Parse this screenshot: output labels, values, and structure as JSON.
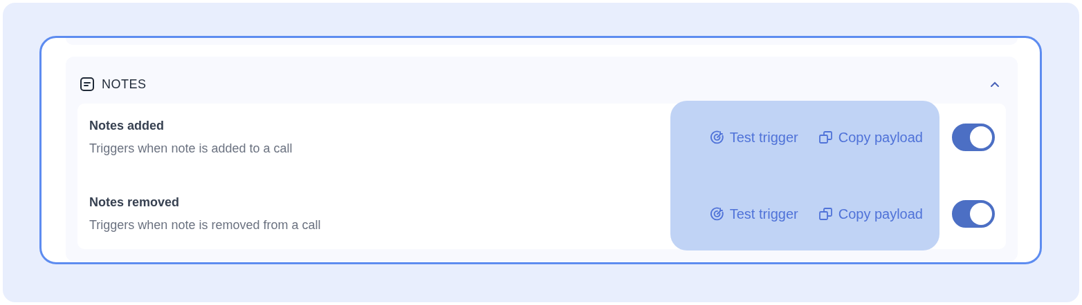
{
  "section": {
    "title": "NOTES",
    "expanded": true,
    "actions_highlighted": true,
    "triggers": [
      {
        "title": "Notes added",
        "description": "Triggers when note is added to a call",
        "test_label": "Test trigger",
        "copy_label": "Copy payload",
        "enabled": true
      },
      {
        "title": "Notes removed",
        "description": "Triggers when note is removed from a call",
        "test_label": "Test trigger",
        "copy_label": "Copy payload",
        "enabled": true
      }
    ]
  }
}
